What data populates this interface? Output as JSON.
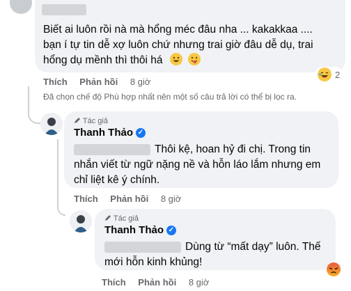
{
  "first_comment": {
    "author_blurred": true,
    "text_line1": "Biết ai luôn rồi nà mà hổng méc đâu nha ... kakakkaa ....",
    "text_line2": "bạn í tự tin dễ xợ luôn chứ nhưng trai giờ đâu dễ dụ, trai",
    "text_line3": "hổng dụ mềnh thì thôi há",
    "actions": {
      "like": "Thích",
      "reply": "Phản hồi",
      "time": "8 giờ"
    },
    "reaction_count": "2"
  },
  "filter_notice": "Đã chọn chế độ Phù hợp nhất nên một số câu trả lời có thể bị lọc ra.",
  "reply1": {
    "author_tag": "Tác giả",
    "name": "Thanh Thảo",
    "text_line1": "Thôi kệ, hoan hỷ đi chị. Trong tin",
    "text_line2": "nhắn viết từ ngữ nặng nề và hỗn láo lắm nhưng em",
    "text_line3": "chỉ liệt kê ý chính.",
    "actions": {
      "like": "Thích",
      "reply": "Phản hồi",
      "time": "8 giờ"
    }
  },
  "reply2": {
    "author_tag": "Tác giả",
    "name": "Thanh Thảo",
    "text_line1": "Dùng từ “mất dạy” luôn. Thế",
    "text_line2": "mới hỗn kinh khủng!",
    "actions": {
      "like": "Thích",
      "reply": "Phản hồi",
      "time": "8 giờ"
    }
  },
  "colors": {
    "bubble": "#f0f2f5",
    "secondary_text": "#65676b",
    "verified": "#1877f2"
  }
}
